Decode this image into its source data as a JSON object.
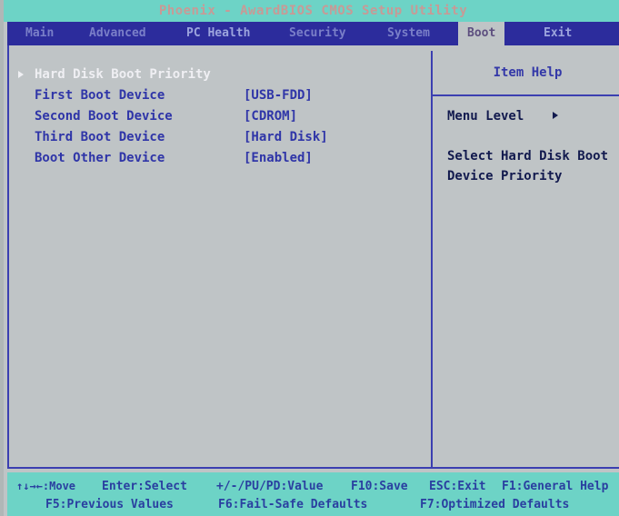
{
  "title": "Phoenix - AwardBIOS CMOS Setup Utility",
  "menu": [
    "Main",
    "Advanced",
    "PC Health",
    "Security",
    "System",
    "Boot",
    "Exit"
  ],
  "active_menu": "Boot",
  "settings": [
    {
      "label": "Hard Disk Boot Priority",
      "value": ""
    },
    {
      "label": "First Boot Device",
      "value": "[USB-FDD]"
    },
    {
      "label": "Second Boot Device",
      "value": "[CDROM]"
    },
    {
      "label": "Third Boot Device",
      "value": "[Hard Disk]"
    },
    {
      "label": "Boot Other Device",
      "value": "[Enabled]"
    }
  ],
  "help": {
    "title": "Item Help",
    "menu_level": "Menu Level",
    "description_line1": "Select Hard Disk Boot",
    "description_line2": "Device Priority"
  },
  "footer": {
    "move": "↑↓→←:Move",
    "enter": "Enter:Select",
    "value": "+/-/PU/PD:Value",
    "save": "F10:Save",
    "exit": "ESC:Exit",
    "help": "F1:General Help",
    "previous": "F5:Previous Values",
    "failsafe": "F6:Fail-Safe Defaults",
    "optimized": "F7:Optimized Defaults"
  },
  "colors": {
    "background": "#bfc4c6",
    "menu_bar": "#2c2c9c",
    "title_bar": "#6dd3c6",
    "text_blue": "#2f35a8",
    "highlight_text": "#efeff3"
  }
}
